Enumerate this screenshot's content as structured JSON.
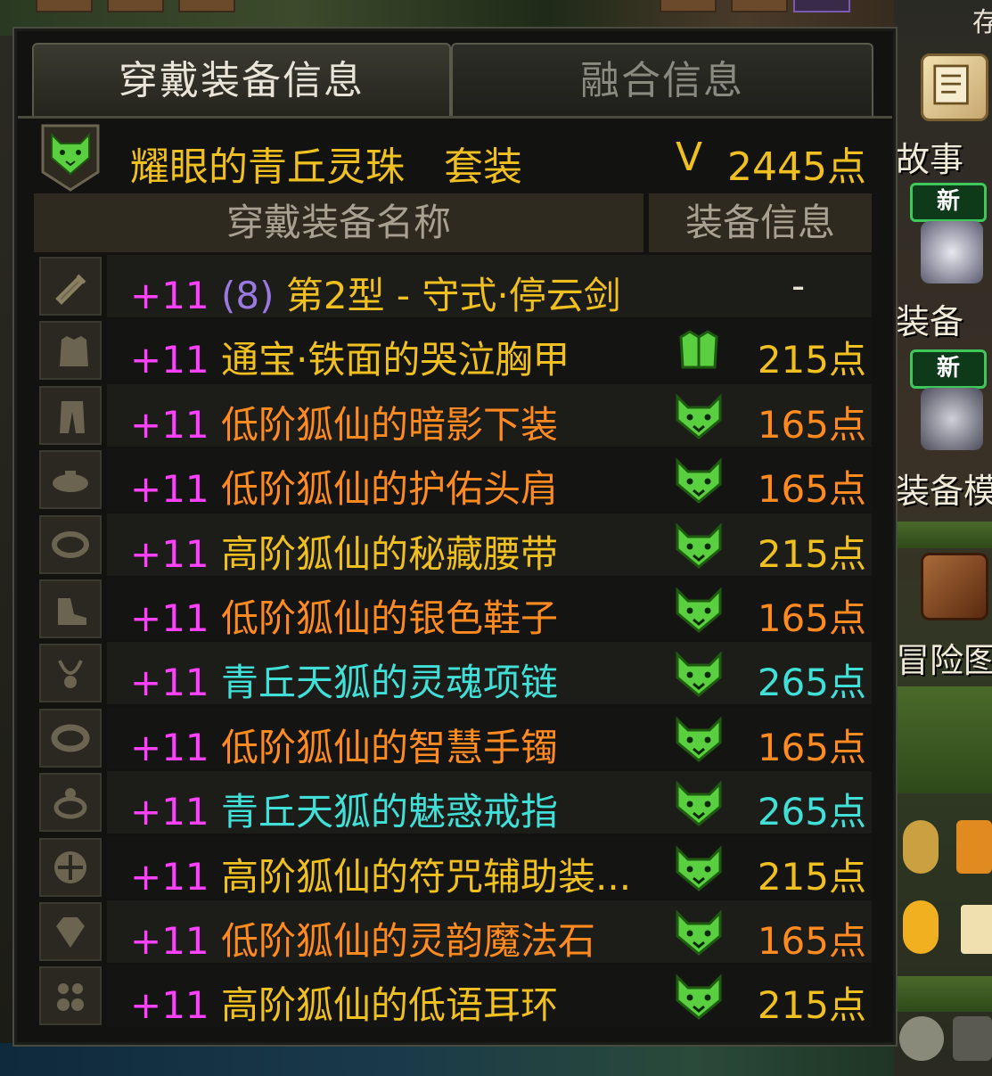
{
  "tabs": {
    "equipped_info": "穿戴装备信息",
    "fusion_info": "融合信息"
  },
  "set_header": {
    "name": "耀眼的青丘灵珠　套装",
    "rank": "V",
    "points": "2445点"
  },
  "table_header": {
    "name_col": "穿戴装备名称",
    "info_col": "装备信息"
  },
  "items": [
    {
      "plus": "+11",
      "gem": "(8)",
      "name": "第2型 - 守式·停云剑",
      "name_color": "#f0c020",
      "set_icon": "none",
      "points": "-",
      "points_color": "#e8e4d8",
      "slot_icon": "weapon-icon"
    },
    {
      "plus": "+11",
      "gem": "",
      "name": "通宝·铁面的哭泣胸甲",
      "name_color": "#f0c020",
      "set_icon": "armor-green-icon",
      "points": "215点",
      "points_color": "#f0c020",
      "slot_icon": "coat-icon"
    },
    {
      "plus": "+11",
      "gem": "",
      "name": "低阶狐仙的暗影下装",
      "name_color": "#ff8a20",
      "set_icon": "fox-icon",
      "points": "165点",
      "points_color": "#ff8a20",
      "slot_icon": "pants-icon"
    },
    {
      "plus": "+11",
      "gem": "",
      "name": "低阶狐仙的护佑头肩",
      "name_color": "#ff8a20",
      "set_icon": "fox-icon",
      "points": "165点",
      "points_color": "#ff8a20",
      "slot_icon": "shoulder-icon"
    },
    {
      "plus": "+11",
      "gem": "",
      "name": "高阶狐仙的秘藏腰带",
      "name_color": "#f0c020",
      "set_icon": "fox-icon",
      "points": "215点",
      "points_color": "#f0c020",
      "slot_icon": "belt-icon"
    },
    {
      "plus": "+11",
      "gem": "",
      "name": "低阶狐仙的银色鞋子",
      "name_color": "#ff8a20",
      "set_icon": "fox-icon",
      "points": "165点",
      "points_color": "#ff8a20",
      "slot_icon": "shoes-icon"
    },
    {
      "plus": "+11",
      "gem": "",
      "name": "青丘天狐的灵魂项链",
      "name_color": "#40e0d8",
      "set_icon": "fox-icon",
      "points": "265点",
      "points_color": "#40e0d8",
      "slot_icon": "necklace-icon"
    },
    {
      "plus": "+11",
      "gem": "",
      "name": "低阶狐仙的智慧手镯",
      "name_color": "#ff8a20",
      "set_icon": "fox-icon",
      "points": "165点",
      "points_color": "#ff8a20",
      "slot_icon": "bracelet-icon"
    },
    {
      "plus": "+11",
      "gem": "",
      "name": "青丘天狐的魅惑戒指",
      "name_color": "#40e0d8",
      "set_icon": "fox-icon",
      "points": "265点",
      "points_color": "#40e0d8",
      "slot_icon": "ring-icon"
    },
    {
      "plus": "+11",
      "gem": "",
      "name": "高阶狐仙的符咒辅助装...",
      "name_color": "#f0c020",
      "set_icon": "fox-icon",
      "points": "215点",
      "points_color": "#f0c020",
      "slot_icon": "subequip-icon"
    },
    {
      "plus": "+11",
      "gem": "",
      "name": "低阶狐仙的灵韵魔法石",
      "name_color": "#ff8a20",
      "set_icon": "fox-icon",
      "points": "165点",
      "points_color": "#ff8a20",
      "slot_icon": "magicstone-icon"
    },
    {
      "plus": "+11",
      "gem": "",
      "name": "高阶狐仙的低语耳环",
      "name_color": "#f0c020",
      "set_icon": "fox-icon",
      "points": "215点",
      "points_color": "#f0c020",
      "slot_icon": "earring-icon"
    }
  ],
  "right_sidebar": {
    "top_label": "存",
    "story_label": "故事",
    "new_badge_1": "新",
    "equip_label": "装备",
    "new_badge_2": "新",
    "equip_mod_label": "装备模",
    "adventure_label": "冒险图"
  },
  "colors": {
    "gold": "#f0c020",
    "orange": "#ff8a20",
    "cyan": "#40e0d8",
    "magenta": "#ff40ff",
    "fox_green": "#5ad040"
  }
}
